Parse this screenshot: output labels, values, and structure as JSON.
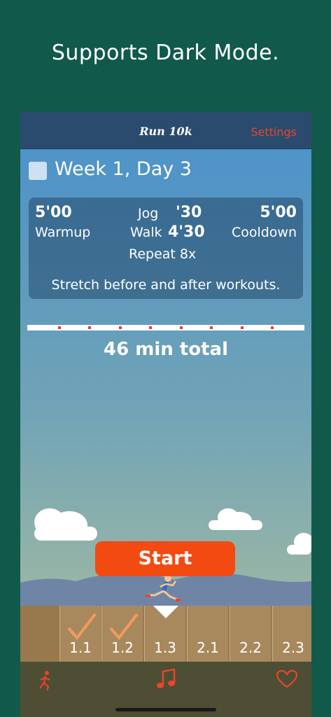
{
  "promo": {
    "text": "Supports Dark Mode."
  },
  "nav": {
    "title": "Run 10k",
    "settings_label": "Settings"
  },
  "workout": {
    "title": "Week 1, Day 3",
    "warmup_time": "5'00",
    "warmup_label": "Warmup",
    "jog_label": "Jog",
    "jog_time": "'30",
    "walk_label": "Walk",
    "walk_time": "4'30",
    "repeat": "Repeat 8x",
    "cooldown_time": "5'00",
    "cooldown_label": "Cooldown",
    "note": "Stretch before and after workouts."
  },
  "total": "46 min total",
  "start_label": "Start",
  "days": [
    {
      "label": "1.1",
      "completed": true
    },
    {
      "label": "1.2",
      "completed": true
    },
    {
      "label": "1.3",
      "completed": false,
      "current": true
    },
    {
      "label": "2.1",
      "completed": false
    },
    {
      "label": "2.2",
      "completed": false
    },
    {
      "label": "2.3",
      "completed": false
    }
  ],
  "tabbar": {
    "icons": [
      "runner-icon",
      "music-note-icon",
      "heart-icon"
    ]
  },
  "colors": {
    "background": "#115a4b",
    "nav_bar": "#2b4b6e",
    "accent": "#f24a10",
    "settings": "#e8462a",
    "tab_bar": "#4d4e34"
  }
}
